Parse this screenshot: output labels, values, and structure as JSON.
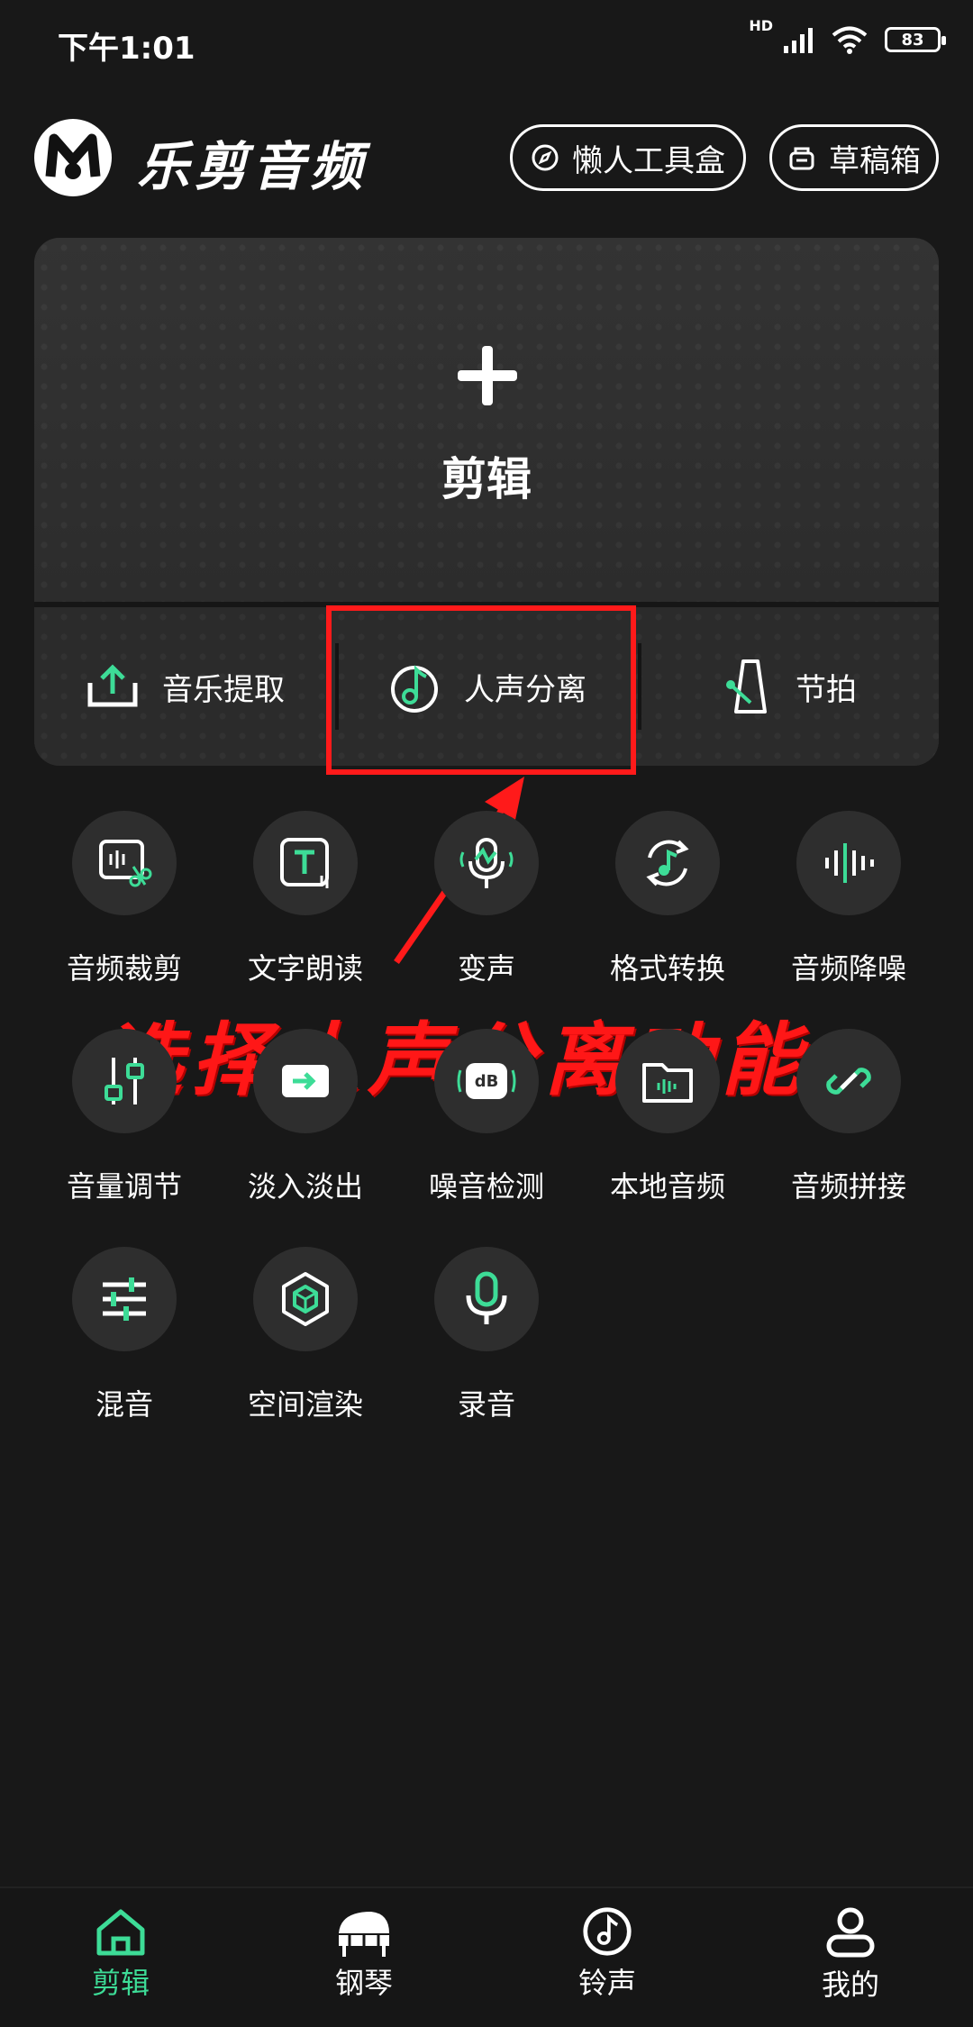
{
  "status": {
    "time": "下午1:01",
    "hd": "HD",
    "battery": "83"
  },
  "header": {
    "title": "乐剪音频",
    "tools_label": "懒人工具盒",
    "drafts_label": "草稿箱"
  },
  "card": {
    "edit_label": "剪辑",
    "quick": [
      {
        "label": "音乐提取"
      },
      {
        "label": "人声分离"
      },
      {
        "label": "节拍"
      }
    ]
  },
  "annotation": {
    "text": "选择人声分离功能"
  },
  "tools": [
    {
      "label": "音频裁剪"
    },
    {
      "label": "文字朗读"
    },
    {
      "label": "变声"
    },
    {
      "label": "格式转换"
    },
    {
      "label": "音频降噪"
    },
    {
      "label": "音量调节"
    },
    {
      "label": "淡入淡出"
    },
    {
      "label": "噪音检测"
    },
    {
      "label": "本地音频"
    },
    {
      "label": "音频拼接"
    },
    {
      "label": "混音"
    },
    {
      "label": "空间渲染"
    },
    {
      "label": "录音"
    }
  ],
  "nav": [
    {
      "label": "剪辑"
    },
    {
      "label": "钢琴"
    },
    {
      "label": "铃声"
    },
    {
      "label": "我的"
    }
  ],
  "colors": {
    "accent": "#3ddc97",
    "annotation": "#ff1a1a",
    "background": "#181818"
  }
}
